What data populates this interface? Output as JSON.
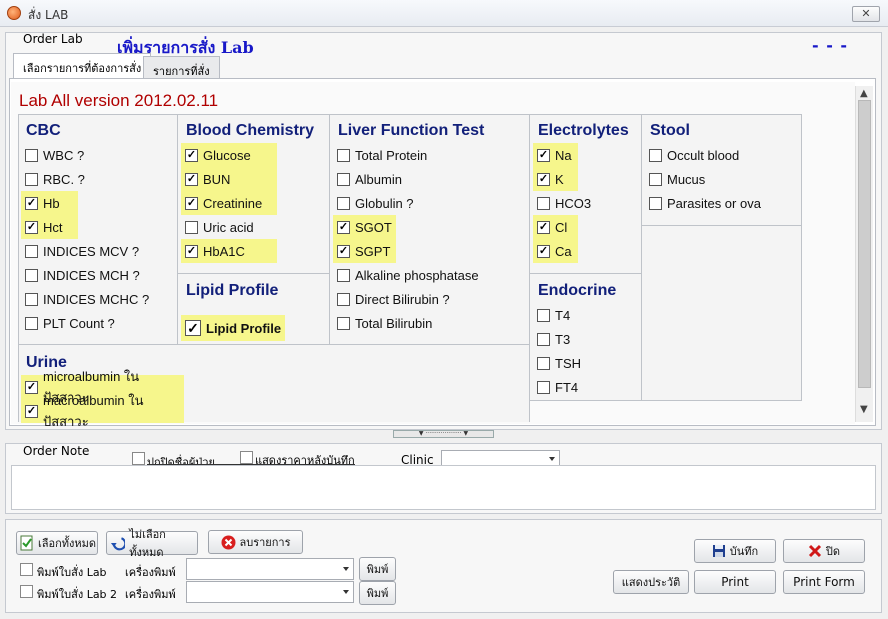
{
  "window": {
    "title": "สั่ง LAB",
    "close_label": "✕"
  },
  "header": {
    "group_label": "Order Lab",
    "heading": "เพิ่มรายการสั่ง Lab",
    "dashes": "- - -"
  },
  "tabs": [
    {
      "label": "เลือกรายการที่ต้องการสั่ง",
      "active": true
    },
    {
      "label": "รายการที่สั่ง",
      "active": false
    }
  ],
  "lab_version": "Lab All version 2012.02.11",
  "categories": {
    "cbc": {
      "title": "CBC",
      "items": [
        {
          "label": "WBC ?",
          "checked": false
        },
        {
          "label": "RBC. ?",
          "checked": false
        },
        {
          "label": "Hb",
          "checked": true
        },
        {
          "label": "Hct",
          "checked": true
        },
        {
          "label": "INDICES MCV ?",
          "checked": false
        },
        {
          "label": "INDICES MCH ?",
          "checked": false
        },
        {
          "label": "INDICES MCHC ?",
          "checked": false
        },
        {
          "label": "PLT Count ?",
          "checked": false
        }
      ]
    },
    "blood_chemistry": {
      "title": "Blood Chemistry",
      "items": [
        {
          "label": "Glucose",
          "checked": true
        },
        {
          "label": "BUN",
          "checked": true
        },
        {
          "label": "Creatinine",
          "checked": true
        },
        {
          "label": "Uric acid",
          "checked": false
        },
        {
          "label": "HbA1C",
          "checked": true
        }
      ]
    },
    "lipid": {
      "title": "Lipid Profile",
      "items": [
        {
          "label": "Lipid Profile",
          "checked": true
        }
      ]
    },
    "liver": {
      "title": "Liver Function Test",
      "items": [
        {
          "label": "Total Protein",
          "checked": false
        },
        {
          "label": "Albumin",
          "checked": false
        },
        {
          "label": "Globulin ?",
          "checked": false
        },
        {
          "label": "SGOT",
          "checked": true
        },
        {
          "label": "SGPT",
          "checked": true
        },
        {
          "label": "Alkaline phosphatase",
          "checked": false
        },
        {
          "label": "Direct Bilirubin ?",
          "checked": false
        },
        {
          "label": "Total Bilirubin",
          "checked": false
        }
      ]
    },
    "electrolytes": {
      "title": "Electrolytes",
      "items": [
        {
          "label": "Na",
          "checked": true
        },
        {
          "label": "K",
          "checked": true
        },
        {
          "label": "HCO3",
          "checked": false
        },
        {
          "label": "Cl",
          "checked": true
        },
        {
          "label": "Ca",
          "checked": true
        }
      ]
    },
    "endocrine": {
      "title": "Endocrine",
      "items": [
        {
          "label": "T4",
          "checked": false
        },
        {
          "label": "T3",
          "checked": false
        },
        {
          "label": "TSH",
          "checked": false
        },
        {
          "label": "FT4",
          "checked": false
        }
      ]
    },
    "stool": {
      "title": "Stool",
      "items": [
        {
          "label": "Occult blood",
          "checked": false
        },
        {
          "label": "Mucus",
          "checked": false
        },
        {
          "label": "Parasites or ova",
          "checked": false
        }
      ]
    },
    "urine": {
      "title": "Urine",
      "items": [
        {
          "label": "microalbumin ในปัสสาวะ",
          "checked": true
        },
        {
          "label": "macroalbumin ในปัสสาวะ",
          "checked": true
        }
      ]
    }
  },
  "order_note": {
    "label": "Order Note",
    "hide_name_label": "ปกปิดชื่อผู้ป่วย",
    "show_price_label": "แสดงราคาหลังบันทึก",
    "clinic_label": "Clinic",
    "clinic_value": ""
  },
  "bottom": {
    "select_all": "เลือกทั้งหมด",
    "deselect_all": "ไม่เลือกทั้งหมด",
    "delete_item": "ลบรายการ",
    "print_lab_label": "พิมพ์ใบสั่ง Lab",
    "print_lab2_label": "พิมพ์ใบสั่ง Lab 2",
    "printer_label": "เครื่องพิมพ์",
    "printer_label2": "เครื่องพิมพ์",
    "print_btn": "พิมพ์",
    "print_btn2": "พิมพ์",
    "save": "บันทึก",
    "close": "ปิด",
    "history": "แสดงประวัติ",
    "print": "Print",
    "print_form": "Print Form"
  }
}
